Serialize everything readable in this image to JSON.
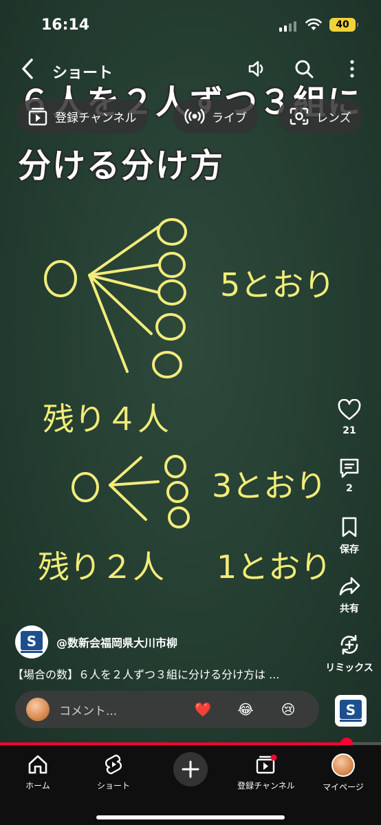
{
  "status_bar": {
    "time": "16:14",
    "battery": "40"
  },
  "top_bar": {
    "back_label": "ショート",
    "pills": [
      {
        "label": "登録チャンネル",
        "icon": "subscriptions-icon"
      },
      {
        "label": "ライブ",
        "icon": "live-icon"
      },
      {
        "label": "レンズ",
        "icon": "lens-icon"
      }
    ],
    "icons": [
      "back-icon",
      "volume-icon",
      "search-icon",
      "more-vert-icon"
    ]
  },
  "video": {
    "title_line1": "６人を２人ずつ３組に",
    "title_line2": "分ける分け方",
    "board": {
      "count_a": "5とおり",
      "remain_a": "残り４人",
      "count_b": "3とおり",
      "remain_c": "残り２人",
      "count_c": "1とおり"
    }
  },
  "actions": {
    "like": {
      "label": "21",
      "icon": "heart-icon"
    },
    "comment": {
      "label": "2",
      "icon": "comment-icon"
    },
    "save": {
      "label": "保存",
      "icon": "bookmark-icon"
    },
    "share": {
      "label": "共有",
      "icon": "share-icon"
    },
    "remix": {
      "label": "リミックス",
      "icon": "remix-icon"
    }
  },
  "channel": {
    "name": "@数新会福岡県大川市柳",
    "logo_text": "S"
  },
  "description": "【場合の数】６人を２人ずつ３組に分ける分け方は ...",
  "comment_bar": {
    "placeholder": "コメント...",
    "emojis": [
      "❤️",
      "😂",
      "😢"
    ]
  },
  "progress": {
    "fraction": 0.91
  },
  "bottom_nav": [
    {
      "label": "ホーム",
      "icon": "home-icon"
    },
    {
      "label": "ショート",
      "icon": "shorts-icon"
    },
    {
      "label": "",
      "icon": "create-icon"
    },
    {
      "label": "登録チャンネル",
      "icon": "subscriptions-icon"
    },
    {
      "label": "マイページ",
      "icon": "avatar"
    }
  ],
  "colors": {
    "accent": "#ff0033",
    "chalk": "#f3ec7a",
    "board": "#243d31",
    "battery": "#f2d23a"
  }
}
